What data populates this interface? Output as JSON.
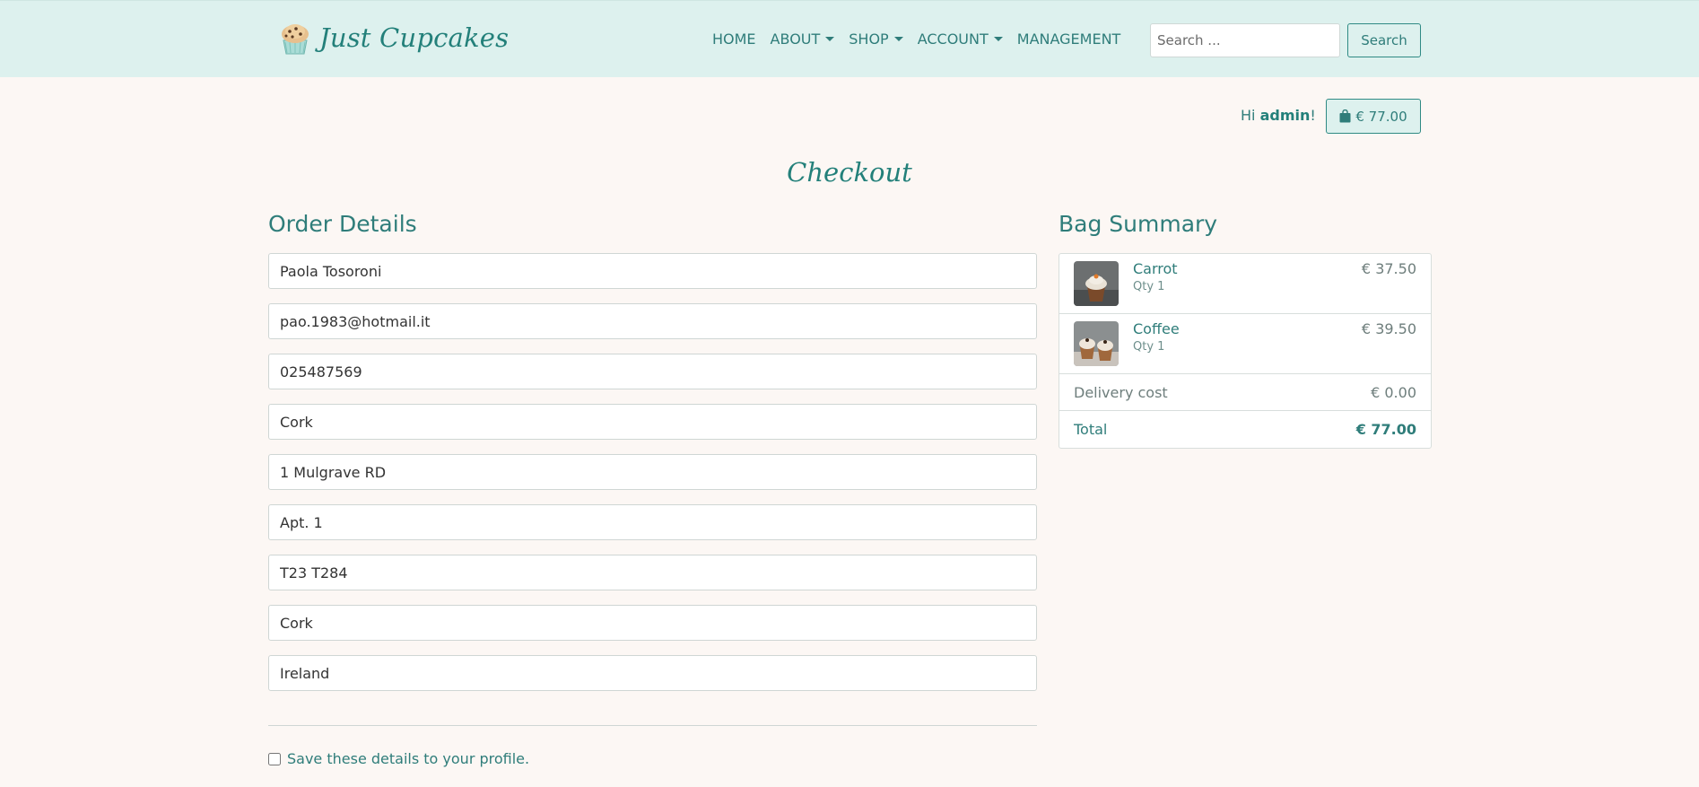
{
  "brand": {
    "name": "Just Cupcakes"
  },
  "nav": {
    "items": [
      {
        "label": "HOME",
        "dropdown": false
      },
      {
        "label": "ABOUT",
        "dropdown": true
      },
      {
        "label": "SHOP",
        "dropdown": true
      },
      {
        "label": "ACCOUNT",
        "dropdown": true
      },
      {
        "label": "MANAGEMENT",
        "dropdown": false
      }
    ],
    "search_placeholder": "Search ...",
    "search_button": "Search"
  },
  "user": {
    "greeting_prefix": "Hi",
    "username": "admin",
    "greeting_suffix": "!",
    "bag_total": "€ 77.00"
  },
  "page": {
    "title": "Checkout"
  },
  "order": {
    "title": "Order Details",
    "fields": {
      "full_name": "Paola Tosoroni",
      "email": "pao.1983@hotmail.it",
      "phone": "025487569",
      "town": "Cork",
      "street1": "1 Mulgrave RD",
      "street2": "Apt. 1",
      "postcode": "T23 T284",
      "county": "Cork",
      "country": "Ireland"
    },
    "save_label": "Save these details to your profile.",
    "save_checked": false
  },
  "summary": {
    "title": "Bag Summary",
    "items": [
      {
        "name": "Carrot",
        "qty": "Qty 1",
        "price": "€ 37.50"
      },
      {
        "name": "Coffee",
        "qty": "Qty 1",
        "price": "€ 39.50"
      }
    ],
    "delivery_label": "Delivery cost",
    "delivery_value": "€ 0.00",
    "total_label": "Total",
    "total_value": "€ 77.00"
  },
  "colors": {
    "accent": "#2f7d7a",
    "navbar_bg": "#ddf1ee",
    "page_bg": "#fcf7f4"
  }
}
